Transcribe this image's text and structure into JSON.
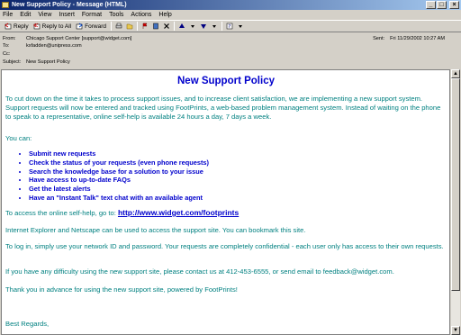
{
  "window": {
    "title": "New Support Policy - Message (HTML)",
    "controls": {
      "minimize": "_",
      "maximize": "□",
      "close": "×"
    }
  },
  "menu": [
    "File",
    "Edit",
    "View",
    "Insert",
    "Format",
    "Tools",
    "Actions",
    "Help"
  ],
  "toolbar": {
    "reply": "Reply",
    "reply_all": "Reply to All",
    "forward": "Forward"
  },
  "header": {
    "from_label": "From:",
    "from_value": "Chicago Support Center [support@widget.com]",
    "to_label": "To:",
    "to_value": "kxfadden@unipress.com",
    "cc_label": "Cc:",
    "cc_value": "",
    "subject_label": "Subject:",
    "subject_value": "New Support Policy",
    "sent_label": "Sent:",
    "sent_value": "Fri 11/29/2002 10:27 AM"
  },
  "message": {
    "title": "New Support Policy",
    "intro": "To cut down on the time it takes to process support issues, and to increase client satisfaction, we are implementing a new support system. Support requests will now be entered and tracked using FootPrints, a web-based problem management system. Instead of waiting on the phone to speak to a representative, online self-help is available 24 hours a day, 7 days a week.",
    "you_can": "You can:",
    "bullets": [
      "Submit new requests",
      "Check the status of your requests (even phone requests)",
      "Search the knowledge base for a solution to your issue",
      "Have access to up-to-date FAQs",
      "Get the latest alerts",
      "Have an \"Instant Talk\" text chat with an available agent"
    ],
    "access_text": "To access the online self-help, go to: ",
    "access_url": "http://www.widget.com/footprints",
    "browsers": "Internet Explorer and Netscape can be used to access the support site. You can bookmark this site.",
    "login": "To log in, simply use your network ID and password. Your requests are completely confidential - each user only has access to their own requests.",
    "difficulty": "If you have any difficulty using the new support site, please contact us at 412-453-6555, or send email to feedback@widget.com.",
    "thanks": "Thank you in advance for using the new support site, powered by FootPrints!",
    "closing": "Best Regards,"
  }
}
